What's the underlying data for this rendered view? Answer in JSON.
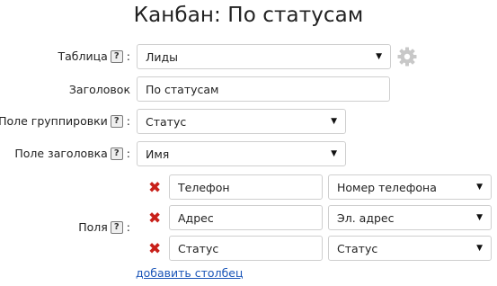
{
  "page": {
    "title": "Канбан: По статусам"
  },
  "form": {
    "table": {
      "label": "Таблица",
      "value": "Лиды"
    },
    "heading": {
      "label": "Заголовок",
      "value": "По статусам"
    },
    "group_field": {
      "label": "Поле группировки",
      "value": "Статус"
    },
    "title_field": {
      "label": "Поле заголовка",
      "value": "Имя"
    },
    "fields": {
      "label": "Поля",
      "items": [
        {
          "name": "Телефон",
          "type": "Номер телефона"
        },
        {
          "name": "Адрес",
          "type": "Эл. адрес"
        },
        {
          "name": "Статус",
          "type": "Статус"
        }
      ],
      "add_link": "добавить столбец"
    }
  },
  "glyphs": {
    "help": "?",
    "colon": ":",
    "dropdown": "▼",
    "remove": "✖"
  },
  "icons": [
    "help-icon",
    "gear-icon",
    "dropdown-arrow-icon",
    "remove-icon"
  ],
  "colors": {
    "remove": "#c8201a",
    "link": "#1a55b8",
    "gear": "#c8c8c8"
  }
}
